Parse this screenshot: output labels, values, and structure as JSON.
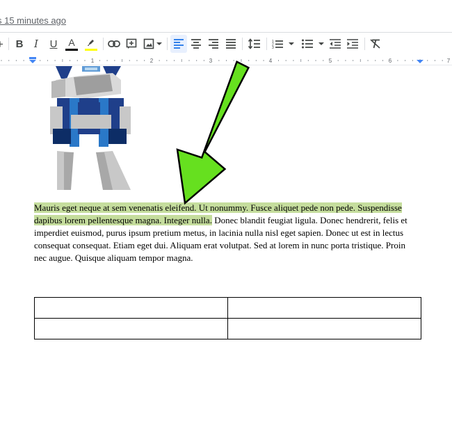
{
  "header": {
    "last_edit": "s 15 minutes ago"
  },
  "toolbar": {
    "bold": "B",
    "italic": "I",
    "underline": "U",
    "text_color": "A",
    "items": [
      "add",
      "bold",
      "italic",
      "underline",
      "text-color",
      "highlight",
      "link",
      "comment",
      "image",
      "align-left",
      "align-center",
      "align-right",
      "justify",
      "line-spacing",
      "numbered-list",
      "bulleted-list",
      "decrease-indent",
      "increase-indent",
      "clear-formatting"
    ],
    "active": "align-left",
    "text_color_swatch": "#000000",
    "highlight_swatch": "#ffff00"
  },
  "ruler": {
    "numbers": [
      "1",
      "2",
      "3",
      "4",
      "5",
      "6",
      "7"
    ],
    "accent": "#4285f4"
  },
  "document": {
    "paragraph_highlighted": "Mauris eget neque at sem venenatis eleifend. Ut nonummy. Fusce aliquet pede non pede. Suspendisse dapibus lorem pellentesque magna. Integer nulla.",
    "paragraph_rest": " Donec blandit feugiat ligula. Donec hendrerit, felis et imperdiet euismod, purus ipsum pretium metus, in lacinia nulla nisl eget sapien. Donec ut est in lectus consequat consequat. Etiam eget dui. Aliquam erat volutpat. Sed at lorem in nunc porta tristique. Proin nec augue. Quisque aliquam tempor magna.",
    "highlight_color": "#c5dd9d",
    "table": {
      "rows": [
        [
          "",
          ""
        ],
        [
          "",
          ""
        ]
      ]
    },
    "image": "robot-illustration"
  },
  "annotation": {
    "arrow_color": "#66e01f"
  }
}
